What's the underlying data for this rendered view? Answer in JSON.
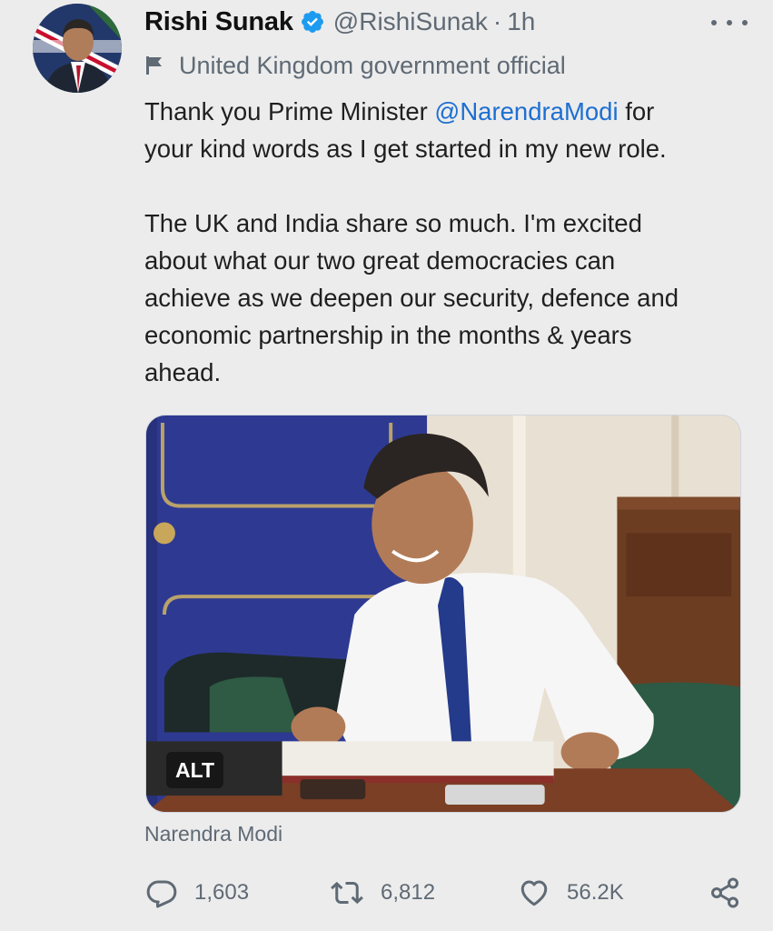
{
  "author": {
    "display_name": "Rishi Sunak",
    "handle": "@RishiSunak",
    "separator": "·",
    "time": "1h",
    "label": "United Kingdom government official"
  },
  "tweet": {
    "line1_before": "Thank you Prime Minister ",
    "mention": "@NarendraModi",
    "line1_after": " for",
    "line2": "your kind words as I get started in my new role.",
    "para2_lines": [
      "The UK and India share so much. I'm excited",
      "about what our two great democracies can",
      "achieve as we deepen our security, defence and",
      "economic partnership in the months & years",
      "ahead."
    ]
  },
  "media": {
    "alt_badge": "ALT",
    "tagged_user": "Narendra Modi"
  },
  "actions": {
    "replies": "1,603",
    "retweets": "6,812",
    "likes": "56.2K"
  },
  "icons": {
    "verified": "verified-badge-icon",
    "label": "flag-icon",
    "more": "more-options-icon",
    "reply": "reply-icon",
    "retweet": "retweet-icon",
    "like": "heart-icon",
    "share": "share-icon"
  },
  "colors": {
    "background": "#ececec",
    "link": "#1d6fd1",
    "verified": "#1d9bf0",
    "muted_text": "#5f6a75"
  }
}
